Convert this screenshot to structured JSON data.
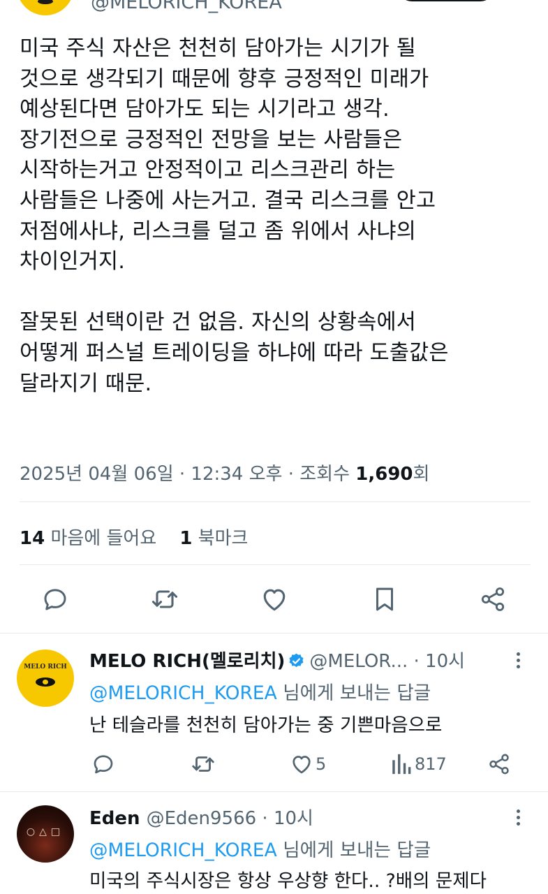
{
  "tweet": {
    "author_handle": "@MELORICH_KOREA",
    "body": "미국 주식 자산은 천천히 담아가는 시기가 될\n것으로 생각되기 때문에 향후 긍정적인 미래가\n예상된다면 담아가도 되는 시기라고 생각.\n장기전으로 긍정적인 전망을 보는 사람들은\n시작하는거고 안정적이고 리스크관리 하는\n사람들은 나중에 사는거고. 결국 리스크를 안고\n저점에사냐, 리스크를 덜고 좀 위에서 사냐의\n차이인거지.\n\n잘못된 선택이란 건 없음. 자신의 상황속에서\n어떻게 퍼스널 트레이딩을 하냐에 따라 도출값은\n달라지기 때문.",
    "timestamp": "2025년 04월 06일 · 12:34 오후 · 조회수 ",
    "views": "1,690",
    "views_unit": "회",
    "likes_count": "14",
    "likes_label": "마음에 들어요",
    "bookmarks_count": "1",
    "bookmarks_label": "북마크"
  },
  "replies": [
    {
      "name": "MELO RICH(멜로리치)",
      "verified": true,
      "handle_time": "@MELOR... · 10시",
      "replying_prefix": "@MELORICH_KOREA",
      "replying_suffix": " 님에게 보내는 답글",
      "text": "난 테슬라를 천천히 담아가는 중 기쁜마음으로",
      "avatar_text": "MELO RICH",
      "likes": "5",
      "views": "817"
    },
    {
      "name": "Eden",
      "handle_time": "@Eden9566 · 10시",
      "replying_prefix": "@MELORICH_KOREA",
      "replying_suffix": " 님에게 보내는 답글",
      "text": "미국의 주식시장은 항상 우상향 한다.. ?배의 문제다"
    }
  ],
  "colors": {
    "text": "#0f1419",
    "secondary": "#536471",
    "link": "#1d9bf0",
    "border": "#e7e9ea",
    "avatar_yellow": "#f7c800"
  },
  "icons": {
    "reply": "speech-bubble-icon",
    "repost": "repost-arrows-icon",
    "like": "heart-icon",
    "bookmark": "bookmark-icon",
    "share": "share-icon",
    "views": "bar-chart-icon",
    "more": "more-vertical-icon",
    "verified": "verified-badge-icon"
  }
}
